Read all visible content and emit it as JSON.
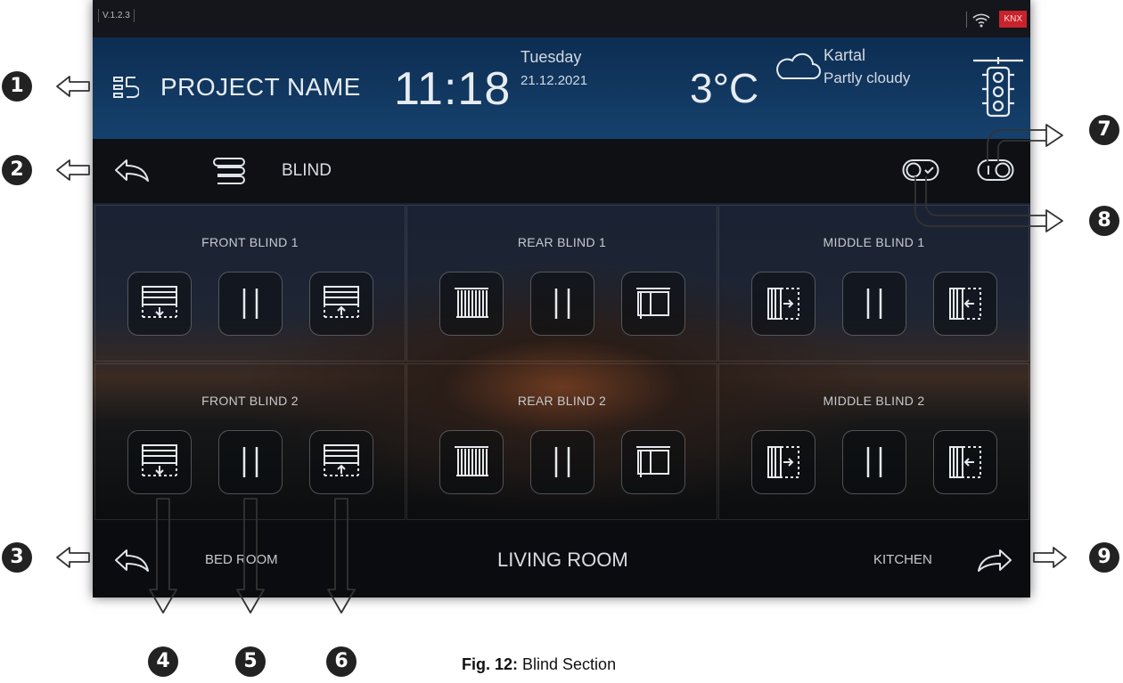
{
  "status_bar": {
    "version": "V.1.2.3",
    "knx_label": "KNX",
    "wifi_icon": "wifi-icon"
  },
  "header": {
    "project_name": "PROJECT NAME",
    "time": "11:18",
    "day": "Tuesday",
    "date": "21.12.2021",
    "temperature": "3°C",
    "city": "Kartal",
    "condition": "Partly cloudy"
  },
  "section": {
    "title": "BLIND"
  },
  "blinds": [
    {
      "name": "FRONT BLIND 1",
      "kind": "roller"
    },
    {
      "name": "REAR BLIND 1",
      "kind": "vertical"
    },
    {
      "name": "MIDDLE BLIND 1",
      "kind": "sliding"
    },
    {
      "name": "FRONT BLIND 2",
      "kind": "roller"
    },
    {
      "name": "REAR BLIND 2",
      "kind": "vertical"
    },
    {
      "name": "MIDDLE BLIND 2",
      "kind": "sliding"
    }
  ],
  "rooms": {
    "prev": "BED ROOM",
    "current": "LIVING ROOM",
    "next": "KITCHEN"
  },
  "callouts": [
    "1",
    "2",
    "3",
    "4",
    "5",
    "6",
    "7",
    "8",
    "9"
  ],
  "caption": {
    "label": "Fig. 12:",
    "text": " Blind Section"
  },
  "colors": {
    "knx": "#c8232c",
    "header": "#15416d",
    "callout": "#222222"
  }
}
